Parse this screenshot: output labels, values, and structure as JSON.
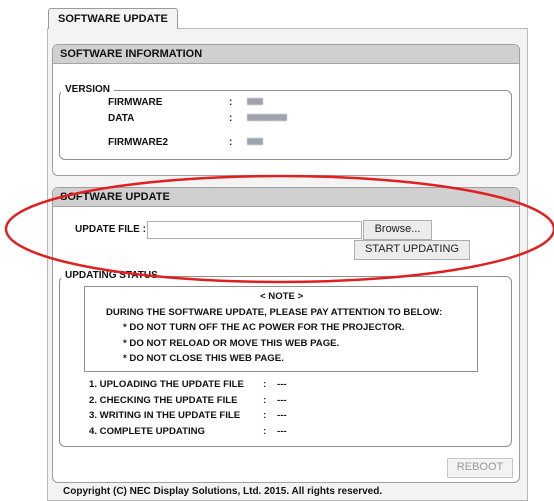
{
  "tab": {
    "label": "SOFTWARE UPDATE"
  },
  "software_info": {
    "header": "SOFTWARE INFORMATION",
    "version_legend": "VERSION",
    "rows": [
      {
        "label": "FIRMWARE",
        "colon": ":"
      },
      {
        "label": "DATA",
        "colon": ":"
      },
      {
        "label": "FIRMWARE2",
        "colon": ":"
      }
    ]
  },
  "software_update": {
    "header": "SOFTWARE UPDATE",
    "file_label": "UPDATE FILE :",
    "file_value": "",
    "browse_label": "Browse...",
    "start_label": "START UPDATING"
  },
  "status": {
    "legend": "UPDATING STATUS",
    "note_title": "< NOTE >",
    "note_intro": "DURING THE SOFTWARE UPDATE, PLEASE PAY ATTENTION TO BELOW:",
    "note_items": [
      "* DO NOT TURN OFF THE AC POWER FOR THE PROJECTOR.",
      "* DO NOT RELOAD OR MOVE THIS WEB PAGE.",
      "* DO NOT CLOSE THIS WEB PAGE."
    ],
    "steps": [
      {
        "label": "1. UPLOADING THE UPDATE FILE",
        "colon": ":",
        "value": "---"
      },
      {
        "label": "2. CHECKING THE UPDATE FILE",
        "colon": ":",
        "value": "---"
      },
      {
        "label": "3. WRITING IN THE UPDATE FILE",
        "colon": ":",
        "value": "---"
      },
      {
        "label": "4. COMPLETE UPDATING",
        "colon": ":",
        "value": "---"
      }
    ]
  },
  "reboot_label": "REBOOT",
  "copyright": "Copyright (C) NEC Display Solutions, Ltd. 2015. All rights reserved.",
  "colors": {
    "annotation_ellipse": "#e02020",
    "panel_header": "#d0d0d0",
    "outer_bg": "#f3f3f3"
  }
}
